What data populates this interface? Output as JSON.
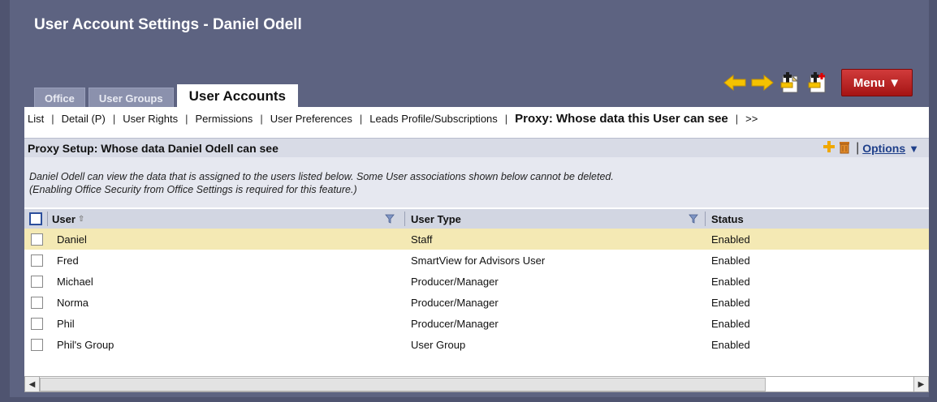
{
  "window": {
    "title": "User Account Settings - Daniel Odell"
  },
  "toolbar": {
    "icons": [
      "arrow-left-icon",
      "arrow-right-icon",
      "doc-pin-icon",
      "doc-pin-add-icon"
    ],
    "menu_label": "Menu ▼"
  },
  "tabs": [
    {
      "label": "Office"
    },
    {
      "label": "User Groups"
    },
    {
      "label": "User Accounts"
    }
  ],
  "subnav": {
    "list": "List",
    "detail": "Detail (P)",
    "user_rights": "User Rights",
    "permissions": "Permissions",
    "user_preferences": "User Preferences",
    "leads_profile": "Leads Profile/Subscriptions",
    "proxy": "Proxy: Whose data this User can see",
    "more": ">>"
  },
  "section": {
    "title": "Proxy Setup: Whose data Daniel Odell can see",
    "options_label": "Options",
    "options_arrow": "▼"
  },
  "description": {
    "line1": "Daniel Odell can view the data that is assigned to the users listed below. Some User associations shown below cannot be deleted.",
    "line2": "(Enabling Office Security from Office Settings is required for this feature.)"
  },
  "table": {
    "headers": {
      "user": "User",
      "user_type": "User Type",
      "status": "Status"
    },
    "rows": [
      {
        "user": "Daniel",
        "type": "Staff",
        "status": "Enabled"
      },
      {
        "user": "Fred",
        "type": "SmartView for Advisors User",
        "status": "Enabled"
      },
      {
        "user": "Michael",
        "type": "Producer/Manager",
        "status": "Enabled"
      },
      {
        "user": "Norma",
        "type": "Producer/Manager",
        "status": "Enabled"
      },
      {
        "user": "Phil",
        "type": "Producer/Manager",
        "status": "Enabled"
      },
      {
        "user": "Phil's Group",
        "type": "User Group",
        "status": "Enabled"
      }
    ]
  },
  "colors": {
    "accent": "#a51414",
    "header_bg": "#5d6381",
    "selected_row": "#f4e9b4"
  }
}
